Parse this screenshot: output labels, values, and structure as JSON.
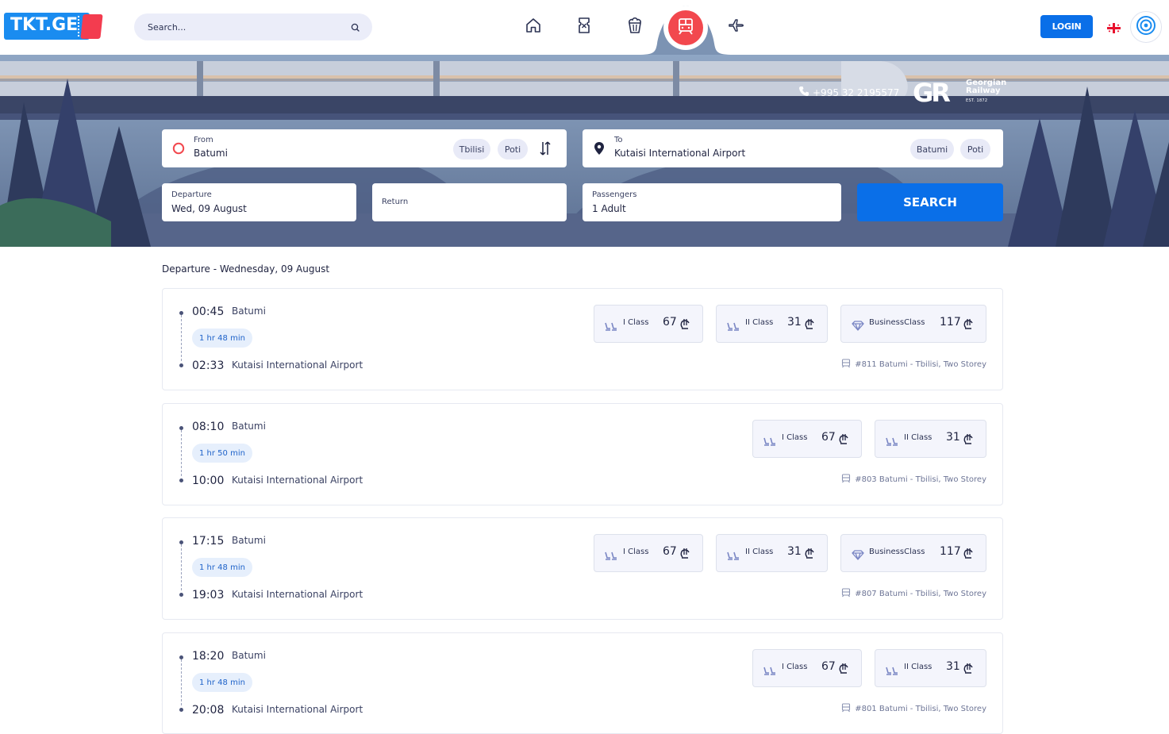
{
  "header": {
    "logo_text": "TKT.GE",
    "search_placeholder": "Search...",
    "nav": [
      {
        "icon": "home-icon"
      },
      {
        "icon": "ticket-icon"
      },
      {
        "icon": "popcorn-icon"
      },
      {
        "icon": "train-icon",
        "active": true
      },
      {
        "icon": "plane-icon"
      }
    ],
    "login_label": "LOGIN",
    "language_flag": "georgia-flag-icon"
  },
  "hero": {
    "phone": "+995 32 2195577",
    "brand_mark": "GR",
    "brand_line1": "Georgian",
    "brand_line2": "Railway",
    "brand_est": "EST. 1872",
    "from": {
      "label": "From",
      "value": "Batumi",
      "chips": [
        "Tbilisi",
        "Poti"
      ]
    },
    "to": {
      "label": "To",
      "value": "Kutaisi International Airport",
      "chips": [
        "Batumi",
        "Poti"
      ]
    },
    "departure": {
      "label": "Departure",
      "value": "Wed, 09 August"
    },
    "return": {
      "label": "Return",
      "value": ""
    },
    "passengers": {
      "label": "Passengers",
      "value": "1 Adult"
    },
    "search_label": "SEARCH"
  },
  "results": {
    "title": "Departure - Wednesday, 09 August",
    "trains": [
      {
        "dep_time": "00:45",
        "dep_city": "Batumi",
        "duration": "1 hr 48 min",
        "arr_time": "02:33",
        "arr_city": "Kutaisi International Airport",
        "classes": [
          {
            "label": "I Class",
            "price": "67",
            "icon": "seat-icon"
          },
          {
            "label": "II Class",
            "price": "31",
            "icon": "seat-icon"
          },
          {
            "label": "BusinessClass",
            "price": "117",
            "icon": "diamond-icon"
          }
        ],
        "info": "#811 Batumi - Tbilisi, Two Storey"
      },
      {
        "dep_time": "08:10",
        "dep_city": "Batumi",
        "duration": "1 hr 50 min",
        "arr_time": "10:00",
        "arr_city": "Kutaisi International Airport",
        "classes": [
          {
            "label": "I Class",
            "price": "67",
            "icon": "seat-icon"
          },
          {
            "label": "II Class",
            "price": "31",
            "icon": "seat-icon"
          }
        ],
        "info": "#803 Batumi - Tbilisi, Two Storey"
      },
      {
        "dep_time": "17:15",
        "dep_city": "Batumi",
        "duration": "1 hr 48 min",
        "arr_time": "19:03",
        "arr_city": "Kutaisi International Airport",
        "classes": [
          {
            "label": "I Class",
            "price": "67",
            "icon": "seat-icon"
          },
          {
            "label": "II Class",
            "price": "31",
            "icon": "seat-icon"
          },
          {
            "label": "BusinessClass",
            "price": "117",
            "icon": "diamond-icon"
          }
        ],
        "info": "#807 Batumi - Tbilisi, Two Storey"
      },
      {
        "dep_time": "18:20",
        "dep_city": "Batumi",
        "duration": "1 hr 48 min",
        "arr_time": "20:08",
        "arr_city": "Kutaisi International Airport",
        "classes": [
          {
            "label": "I Class",
            "price": "67",
            "icon": "seat-icon"
          },
          {
            "label": "II Class",
            "price": "31",
            "icon": "seat-icon"
          }
        ],
        "info": "#801 Batumi - Tbilisi, Two Storey"
      }
    ]
  },
  "colors": {
    "brand_blue": "#0a6fe8",
    "brand_red": "#f2484e",
    "chip_bg": "#e8eaf7",
    "duration_bg": "#e6effc"
  }
}
